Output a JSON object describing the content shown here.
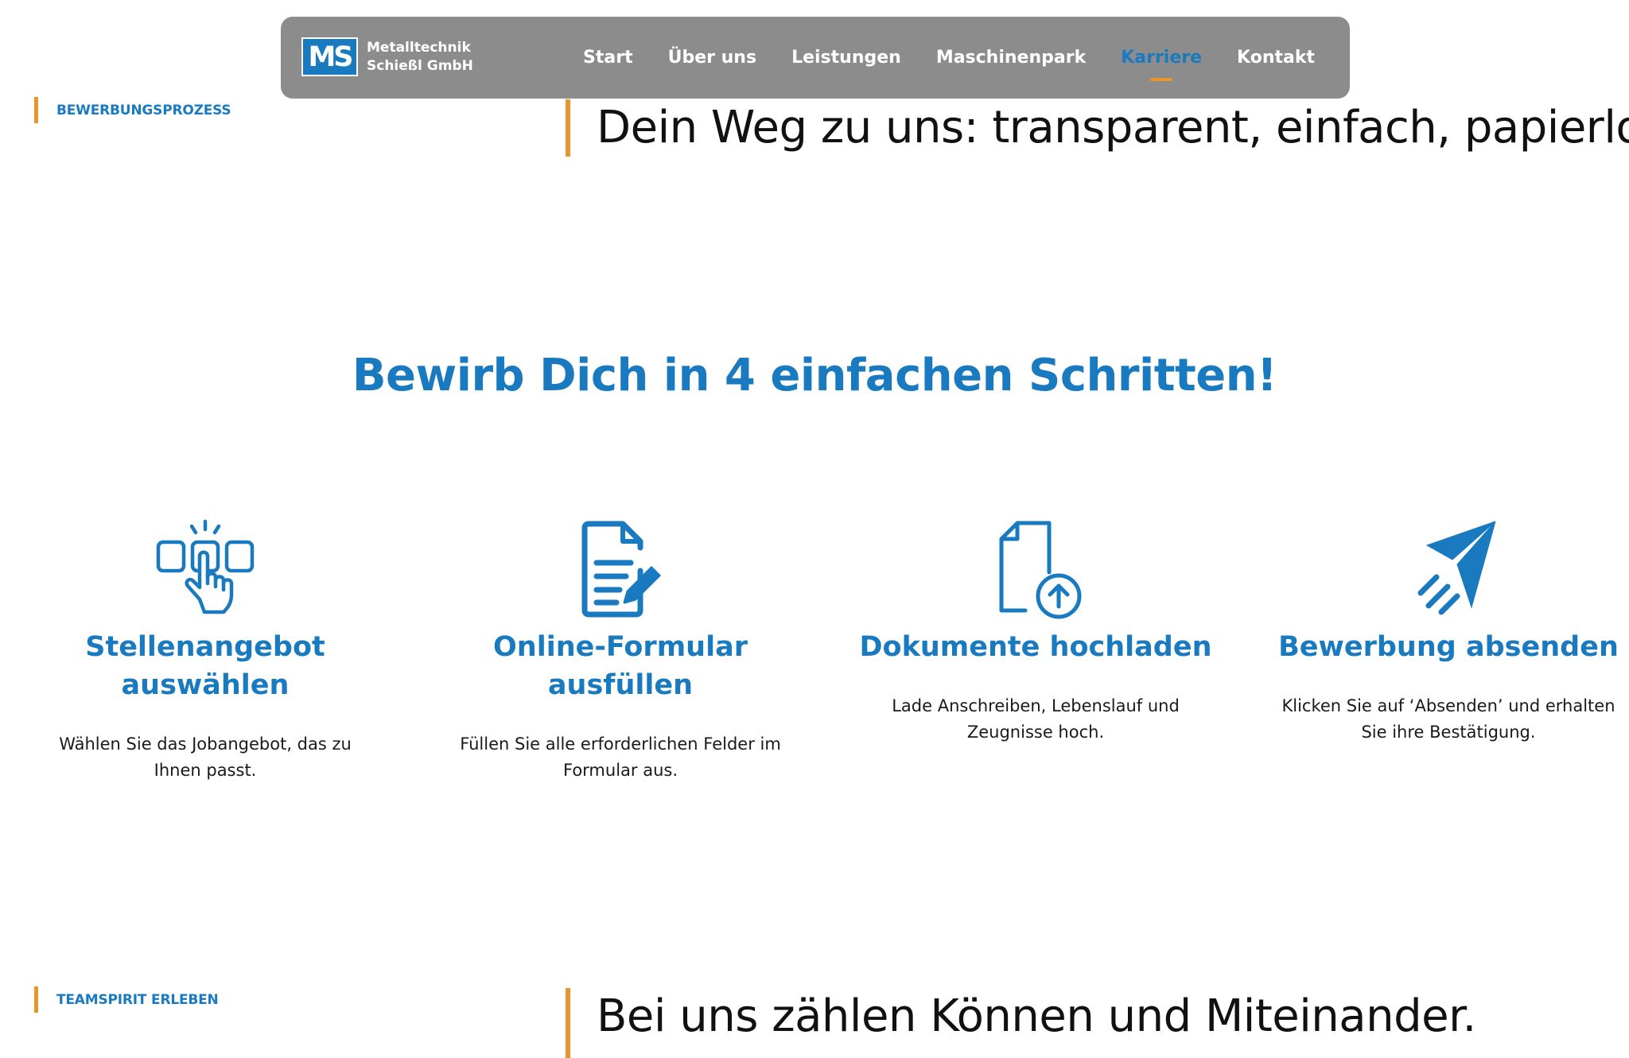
{
  "header": {
    "logo": {
      "mark": "MS",
      "line1": "Metalltechnik",
      "line2": "Schießl GmbH"
    },
    "nav": [
      {
        "label": "Start",
        "active": false
      },
      {
        "label": "Über uns",
        "active": false
      },
      {
        "label": "Leistungen",
        "active": false
      },
      {
        "label": "Maschinenpark",
        "active": false
      },
      {
        "label": "Karriere",
        "active": true
      },
      {
        "label": "Kontakt",
        "active": false
      }
    ]
  },
  "process": {
    "tag": "BEWERBUNGSPROZESS",
    "heading": "Dein Weg zu uns: transparent, einfach, papierlos."
  },
  "steps_title": "Bewirb Dich in 4 einfachen Schritten!",
  "steps": [
    {
      "icon": "hand-select-icon",
      "title_line1": "Stellenangebot",
      "title_line2": "auswählen",
      "desc_line1": "Wählen Sie das Jobangebot, das zu",
      "desc_line2": "Ihnen passt."
    },
    {
      "icon": "form-edit-icon",
      "title_line1": "Online-Formular",
      "title_line2": "ausfüllen",
      "desc_line1": "Füllen Sie alle erforderlichen Felder im",
      "desc_line2": "Formular aus."
    },
    {
      "icon": "document-upload-icon",
      "title_line1": "Dokumente hochladen",
      "title_line2": "",
      "desc_line1": "Lade Anschreiben, Lebenslauf und",
      "desc_line2": "Zeugnisse hoch."
    },
    {
      "icon": "paper-plane-icon",
      "title_line1": "Bewerbung absenden",
      "title_line2": "",
      "desc_line1": "Klicken Sie auf ‘Absenden’ und erhalten",
      "desc_line2": "Sie ihre Bestätigung."
    }
  ],
  "team": {
    "tag": "TEAMSPIRIT ERLEBEN",
    "heading": "Bei uns zählen Können und Miteinander."
  },
  "colors": {
    "brand_blue": "#1a7ac0",
    "accent_orange": "#e8952a",
    "nav_bg": "#8c8c8c"
  }
}
